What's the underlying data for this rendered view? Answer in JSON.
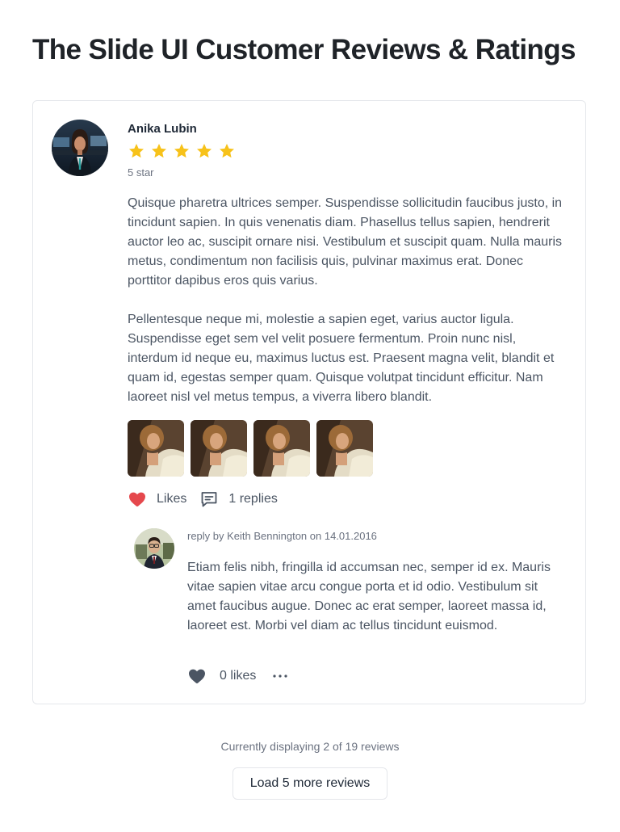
{
  "page": {
    "title": "The Slide UI Customer Reviews & Ratings"
  },
  "review": {
    "reviewer_name": "Anika Lubin",
    "rating": 5,
    "rating_label": "5 star",
    "paragraphs": [
      "Quisque pharetra ultrices semper. Suspendisse sollicitudin faucibus justo, in tincidunt sapien. In quis venenatis diam. Phasellus tellus sapien, hendrerit auctor leo ac, suscipit ornare nisi. Vestibulum et suscipit quam. Nulla mauris metus, condimentum non facilisis quis, pulvinar maximus erat. Donec porttitor dapibus eros quis varius.",
      "Pellentesque neque mi, molestie a sapien eget, varius auctor ligula. Suspendisse eget sem vel velit posuere fermentum. Proin nunc nisl, interdum id neque eu, maximus luctus est. Praesent magna velit, blandit et quam id, egestas semper quam. Quisque volutpat tincidunt efficitur. Nam laoreet nisl vel metus tempus, a viverra libero blandit."
    ],
    "photo_count": 4,
    "likes_label": "Likes",
    "replies_label": "1 replies",
    "icons": {
      "like": "heart-icon",
      "replies": "comment-icon"
    },
    "reply": {
      "meta": "reply by Keith Bennington on 14.01.2016",
      "text": "Etiam felis nibh, fringilla id accumsan nec, semper id ex. Mauris vitae sapien vitae arcu congue porta et id odio. Vestibulum sit amet faucibus augue. Donec ac erat semper, laoreet massa id, laoreet est. Morbi vel diam ac tellus tincidunt euismod.",
      "likes_label": "0 likes",
      "icons": {
        "like": "heart-icon",
        "more": "more-horizontal-icon"
      }
    }
  },
  "footer": {
    "status": "Currently displaying 2 of 19 reviews",
    "load_more_label": "Load 5 more reviews"
  },
  "colors": {
    "star": "#f7c21a",
    "liked_heart": "#e5484d",
    "reply_heart": "#4b5563",
    "text_primary": "#1f2328",
    "text_body": "#4b5563",
    "text_muted": "#6b7280",
    "border": "#e5e7eb"
  }
}
